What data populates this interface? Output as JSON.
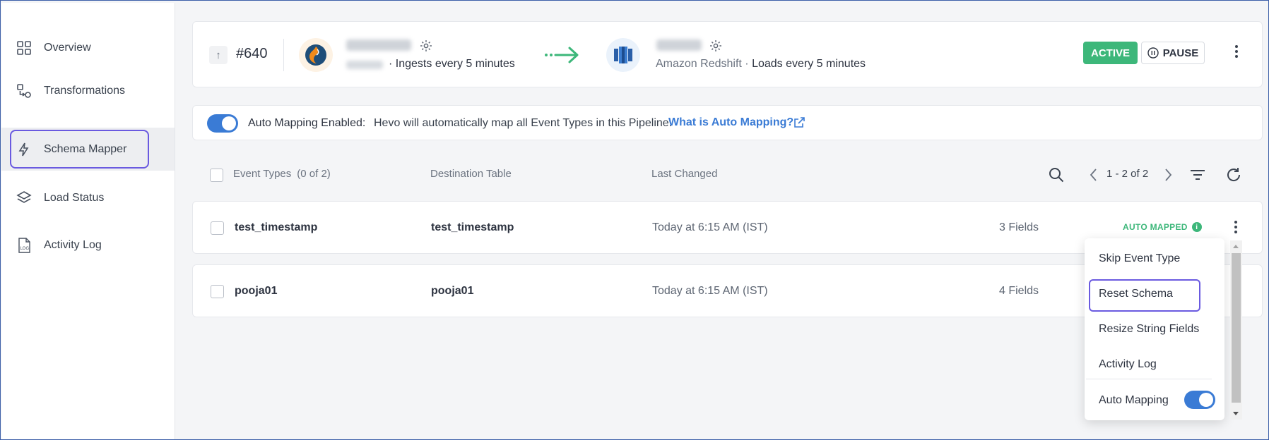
{
  "sidebar": {
    "items": [
      {
        "label": "Overview",
        "icon": "grid-icon"
      },
      {
        "label": "Transformations",
        "icon": "transform-icon"
      },
      {
        "label": "Schema Mapper",
        "icon": "bolt-icon",
        "active": true
      },
      {
        "label": "Load Status",
        "icon": "layers-icon"
      },
      {
        "label": "Activity Log",
        "icon": "log-file-icon"
      }
    ]
  },
  "pipeline": {
    "number": "#640",
    "source": {
      "subtitle": "Ingests every 5 minutes",
      "icon": "source-db-icon"
    },
    "destination": {
      "type": "Amazon Redshift",
      "subtitle": "Loads every 5 minutes",
      "icon": "redshift-icon"
    },
    "status": "ACTIVE",
    "pause_label": "PAUSE"
  },
  "auto_mapping": {
    "label": "Auto Mapping Enabled:",
    "text": "Hevo will automatically map all Event Types in this Pipeline.",
    "link": "What is Auto Mapping?",
    "enabled": true
  },
  "table": {
    "headers": {
      "event_types": "Event Types",
      "count": "(0 of 2)",
      "destination": "Destination Table",
      "last_changed": "Last Changed"
    },
    "pagination": "1 - 2 of 2",
    "rows": [
      {
        "event": "test_timestamp",
        "destination": "test_timestamp",
        "changed": "Today at 6:15 AM (IST)",
        "fields": "3 Fields",
        "status": "AUTO MAPPED"
      },
      {
        "event": "pooja01",
        "destination": "pooja01",
        "changed": "Today at 6:15 AM (IST)",
        "fields": "4 Fields"
      }
    ]
  },
  "menu": {
    "items": [
      "Skip Event Type",
      "Reset Schema",
      "Resize String Fields",
      "Activity Log"
    ],
    "auto_mapping_label": "Auto Mapping",
    "auto_mapping_on": true
  },
  "colors": {
    "accent": "#3a7bd5",
    "active_green": "#3db77a",
    "highlight": "#6a5ae0"
  }
}
